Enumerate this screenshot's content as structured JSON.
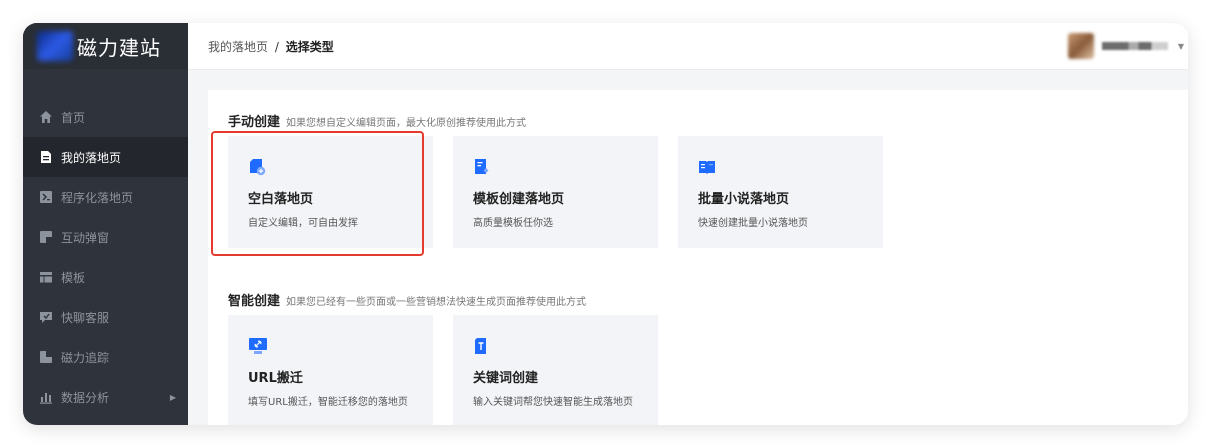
{
  "app": {
    "logo_text": "磁力建站"
  },
  "sidebar": {
    "items": [
      {
        "label": "首页",
        "icon": "home-icon"
      },
      {
        "label": "我的落地页",
        "icon": "document-icon",
        "active": true
      },
      {
        "label": "程序化落地页",
        "icon": "program-icon"
      },
      {
        "label": "互动弹窗",
        "icon": "popup-icon"
      },
      {
        "label": "模板",
        "icon": "template-icon"
      },
      {
        "label": "快聊客服",
        "icon": "chat-icon"
      },
      {
        "label": "磁力追踪",
        "icon": "tracking-icon"
      },
      {
        "label": "数据分析",
        "icon": "bar-chart-icon"
      }
    ]
  },
  "header": {
    "breadcrumb": {
      "parent": "我的落地页",
      "separator": "/",
      "current": "选择类型"
    }
  },
  "manual": {
    "title": "手动创建",
    "desc": "如果您想自定义编辑页面，最大化原创推荐使用此方式",
    "cards": [
      {
        "title": "空白落地页",
        "desc": "自定义编辑，可自由发挥",
        "icon": "blank-page-icon"
      },
      {
        "title": "模板创建落地页",
        "desc": "高质量模板任你选",
        "icon": "template-page-icon"
      },
      {
        "title": "批量小说落地页",
        "desc": "快速创建批量小说落地页",
        "icon": "book-icon"
      }
    ]
  },
  "smart": {
    "title": "智能创建",
    "desc": "如果您已经有一些页面或一些营销想法快速生成页面推荐使用此方式",
    "cards": [
      {
        "title": "URL搬迁",
        "desc": "填写URL搬迁，智能迁移您的落地页",
        "icon": "link-monitor-icon"
      },
      {
        "title": "关键词创建",
        "desc": "输入关键词帮您快速智能生成落地页",
        "icon": "keyword-icon"
      }
    ]
  },
  "colors": {
    "accent": "#1f6bff",
    "sidebar_bg": "#2f333b",
    "highlight": "#e53b2f"
  }
}
